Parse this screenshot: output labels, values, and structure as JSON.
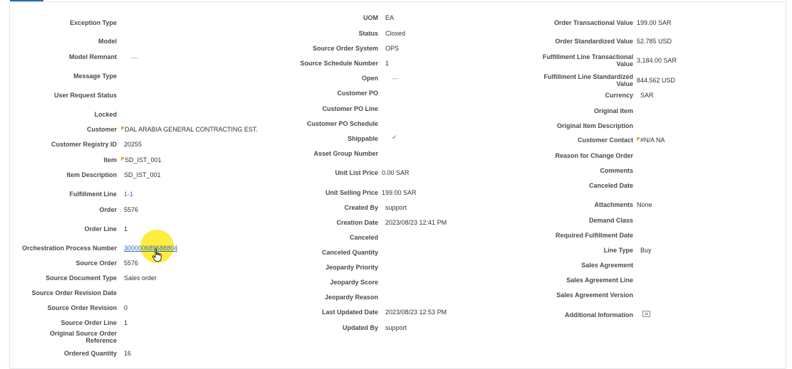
{
  "col1": [
    {
      "label": "Exception Type",
      "value": ""
    },
    {
      "label": "Model",
      "value": ""
    },
    {
      "label": "Model Remnant",
      "value": "—"
    },
    {
      "label": "Message Type",
      "value": ""
    },
    {
      "label": "User Request Status",
      "value": ""
    },
    {
      "label": "Locked",
      "value": ""
    },
    {
      "label": "Customer",
      "value": "DAL ARABIA GENERAL CONTRACTING EST."
    },
    {
      "label": "Customer Registry ID",
      "value": "20255"
    },
    {
      "label": "Item",
      "value": "SD_IST_001"
    },
    {
      "label": "Item Description",
      "value": "SD_IST_001"
    },
    {
      "label": "Fulfillment Line",
      "value": "1-1"
    },
    {
      "label": "Order",
      "value": "5576"
    },
    {
      "label": "Order Line",
      "value": "1"
    },
    {
      "label": "Orchestration Process Number",
      "value": "300000689688804"
    },
    {
      "label": "Source Order",
      "value": "5576"
    },
    {
      "label": "Source Document Type",
      "value": "Sales order"
    },
    {
      "label": "Source Order Revision Date",
      "value": ""
    },
    {
      "label": "Source Order Revision",
      "value": "0"
    },
    {
      "label": "Source Order Line",
      "value": "1"
    },
    {
      "label": "Original Source Order Reference",
      "value": ""
    },
    {
      "label": "Ordered Quantity",
      "value": "16"
    }
  ],
  "col2": [
    {
      "label": "UOM",
      "value": "EA"
    },
    {
      "label": "Status",
      "value": "Closed"
    },
    {
      "label": "Source Order System",
      "value": "OPS"
    },
    {
      "label": "Source Schedule Number",
      "value": "1"
    },
    {
      "label": "Open",
      "value": "—"
    },
    {
      "label": "Customer PO",
      "value": ""
    },
    {
      "label": "Customer PO Line",
      "value": ""
    },
    {
      "label": "Customer PO Schedule",
      "value": ""
    },
    {
      "label": "Shippable",
      "value": "✓"
    },
    {
      "label": "Asset Group Number",
      "value": ""
    },
    {
      "label": "Unit List Price",
      "value": "0.00 SAR"
    },
    {
      "label": "Unit Selling Price",
      "value": "199.00 SAR"
    },
    {
      "label": "Created By",
      "value": "support"
    },
    {
      "label": "Creation Date",
      "value": "2023/08/23 12:41 PM"
    },
    {
      "label": "Canceled",
      "value": ""
    },
    {
      "label": "Canceled Quantity",
      "value": ""
    },
    {
      "label": "Jeopardy Priority",
      "value": ""
    },
    {
      "label": "Jeopardy Score",
      "value": ""
    },
    {
      "label": "Jeopardy Reason",
      "value": ""
    },
    {
      "label": "Last Updated Date",
      "value": "2023/08/23 12:53 PM"
    },
    {
      "label": "Updated By",
      "value": "support"
    }
  ],
  "col3": [
    {
      "label": "Order Transactional Value",
      "value": "199.00 SAR"
    },
    {
      "label": "Order Standardized Value",
      "value": "52.785 USD"
    },
    {
      "label": "Fulfillment Line Transactional Value",
      "value": "3,184.00 SAR"
    },
    {
      "label": "Fulfillment Line Standardized Value",
      "value": "844.562 USD"
    },
    {
      "label": "Currency",
      "value": "SAR"
    },
    {
      "label": "Original Item",
      "value": ""
    },
    {
      "label": "Original Item Description",
      "value": ""
    },
    {
      "label": "Customer Contact",
      "value": "#N/A NA"
    },
    {
      "label": "Reason for Change Order",
      "value": ""
    },
    {
      "label": "Comments",
      "value": ""
    },
    {
      "label": "Canceled Date",
      "value": ""
    },
    {
      "label": "Attachments",
      "value": "None"
    },
    {
      "label": "Demand Class",
      "value": ""
    },
    {
      "label": "Required Fulfillment Date",
      "value": ""
    },
    {
      "label": "Line Type",
      "value": "Buy"
    },
    {
      "label": "Sales Agreement",
      "value": ""
    },
    {
      "label": "Sales Agreement Line",
      "value": ""
    },
    {
      "label": "Sales Agreement Version",
      "value": ""
    },
    {
      "label": "Additional Information",
      "value": ""
    }
  ],
  "icons": {
    "flag": "flag-icon",
    "additional_info": "note-icon",
    "cursor": "hand-pointer-icon"
  },
  "colors": {
    "link": "#2c6bb3",
    "tab_accent": "#2a6bb4",
    "flag": "#f0a33a",
    "highlight": "#ffe91e"
  }
}
